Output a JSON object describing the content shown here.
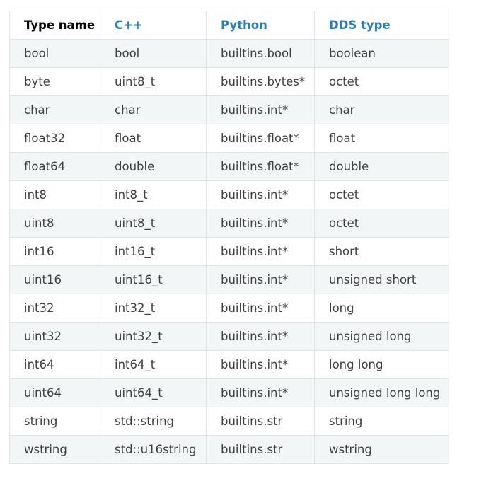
{
  "table": {
    "headers": [
      "Type name",
      "C++",
      "Python",
      "DDS type"
    ],
    "rows": [
      [
        "bool",
        "bool",
        "builtins.bool",
        "boolean"
      ],
      [
        "byte",
        "uint8_t",
        "builtins.bytes*",
        "octet"
      ],
      [
        "char",
        "char",
        "builtins.int*",
        "char"
      ],
      [
        "float32",
        "float",
        "builtins.float*",
        "float"
      ],
      [
        "float64",
        "double",
        "builtins.float*",
        "double"
      ],
      [
        "int8",
        "int8_t",
        "builtins.int*",
        "octet"
      ],
      [
        "uint8",
        "uint8_t",
        "builtins.int*",
        "octet"
      ],
      [
        "int16",
        "int16_t",
        "builtins.int*",
        "short"
      ],
      [
        "uint16",
        "uint16_t",
        "builtins.int*",
        "unsigned short"
      ],
      [
        "int32",
        "int32_t",
        "builtins.int*",
        "long"
      ],
      [
        "uint32",
        "uint32_t",
        "builtins.int*",
        "unsigned long"
      ],
      [
        "int64",
        "int64_t",
        "builtins.int*",
        "long long"
      ],
      [
        "uint64",
        "uint64_t",
        "builtins.int*",
        "unsigned long long"
      ],
      [
        "string",
        "std::string",
        "builtins.str",
        "string"
      ],
      [
        "wstring",
        "std::u16string",
        "builtins.str",
        "wstring"
      ]
    ]
  },
  "colors": {
    "header_accent": "#2980b9",
    "stripe": "#f3f6f6",
    "border": "#e1e4e5",
    "text": "#404040"
  }
}
